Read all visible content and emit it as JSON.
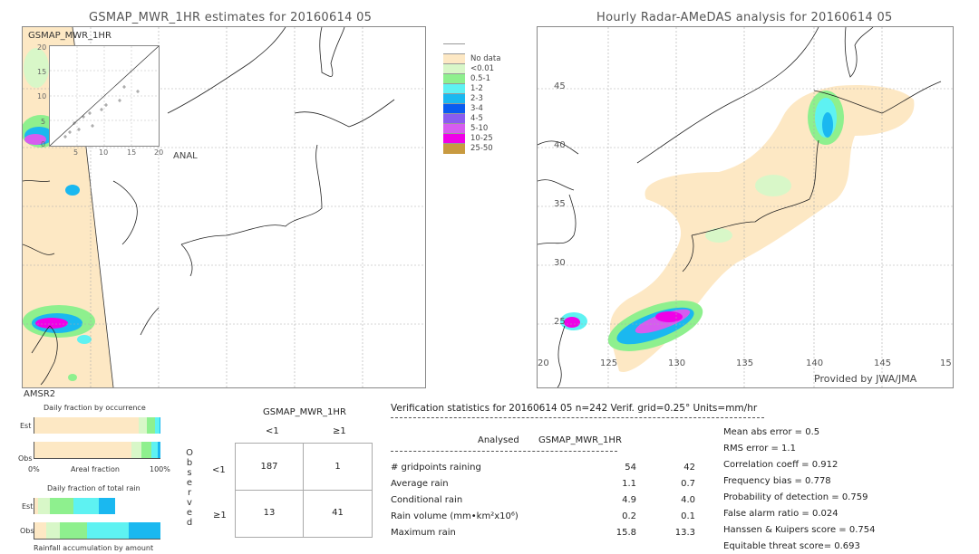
{
  "left_panel": {
    "title": "GSMAP_MWR_1HR estimates for 20160614 05",
    "inset_label": "GSMAP_MWR_1HR",
    "inset_axis_y": [
      "20",
      "15",
      "10",
      "5",
      "0"
    ],
    "inset_axis_x": [
      "5",
      "10",
      "15",
      "20"
    ],
    "inset_xlabel": "ANAL",
    "sensor_label": "AMSR2"
  },
  "right_panel": {
    "title": "Hourly Radar-AMeDAS analysis for 20160614 05",
    "lat_labels": [
      "45",
      "40",
      "35",
      "30",
      "25"
    ],
    "lon_labels": [
      "20",
      "125",
      "130",
      "135",
      "140",
      "145",
      "15"
    ],
    "credit": "Provided by JWA/JMA"
  },
  "legend": {
    "items": [
      {
        "label": "No data",
        "color": "#fde8c4"
      },
      {
        "label": "<0.01",
        "color": "#d8f7c8"
      },
      {
        "label": "0.5-1",
        "color": "#8ef08e"
      },
      {
        "label": "1-2",
        "color": "#5ef2f2"
      },
      {
        "label": "2-3",
        "color": "#1ab8f0"
      },
      {
        "label": "3-4",
        "color": "#0a5cf0"
      },
      {
        "label": "4-5",
        "color": "#8a5cf0"
      },
      {
        "label": "5-10",
        "color": "#d65cf0"
      },
      {
        "label": "10-25",
        "color": "#f000e8"
      },
      {
        "label": "25-50",
        "color": "#c89a40"
      }
    ],
    "top_color": "#ffffff"
  },
  "fraction_charts": {
    "occurrence_title": "Daily fraction by occurrence",
    "est_label": "Est",
    "obs_label": "Obs",
    "axis_left": "0%",
    "axis_mid": "Areal fraction",
    "axis_right": "100%",
    "total_rain_title": "Daily fraction of total rain",
    "accum_title": "Rainfall accumulation by amount",
    "occurrence_est": [
      {
        "fraction": 0.83,
        "color": "#fde8c4"
      },
      {
        "fraction": 0.06,
        "color": "#d8f7c8"
      },
      {
        "fraction": 0.07,
        "color": "#8ef08e"
      },
      {
        "fraction": 0.03,
        "color": "#5ef2f2"
      },
      {
        "fraction": 0.01,
        "color": "#1ab8f0"
      }
    ],
    "occurrence_obs": [
      {
        "fraction": 0.77,
        "color": "#fde8c4"
      },
      {
        "fraction": 0.08,
        "color": "#d8f7c8"
      },
      {
        "fraction": 0.08,
        "color": "#8ef08e"
      },
      {
        "fraction": 0.05,
        "color": "#5ef2f2"
      },
      {
        "fraction": 0.02,
        "color": "#1ab8f0"
      }
    ],
    "total_est": [
      {
        "fraction": 0.03,
        "color": "#fde8c4"
      },
      {
        "fraction": 0.09,
        "color": "#d8f7c8"
      },
      {
        "fraction": 0.19,
        "color": "#8ef08e"
      },
      {
        "fraction": 0.2,
        "color": "#5ef2f2"
      },
      {
        "fraction": 0.13,
        "color": "#1ab8f0"
      }
    ],
    "total_obs": [
      {
        "fraction": 0.09,
        "color": "#fde8c4"
      },
      {
        "fraction": 0.11,
        "color": "#d8f7c8"
      },
      {
        "fraction": 0.22,
        "color": "#8ef08e"
      },
      {
        "fraction": 0.33,
        "color": "#5ef2f2"
      },
      {
        "fraction": 0.25,
        "color": "#1ab8f0"
      }
    ]
  },
  "contingency": {
    "title": "GSMAP_MWR_1HR",
    "col_headers": [
      "<1",
      "≥1"
    ],
    "row_headers": [
      "<1",
      "≥1"
    ],
    "observed_label": [
      "O",
      "b",
      "s",
      "e",
      "r",
      "v",
      "e",
      "d"
    ],
    "cells": [
      [
        "187",
        "1"
      ],
      [
        "13",
        "41"
      ]
    ]
  },
  "verification": {
    "header": "Verification statistics for 20160614 05   n=242   Verif. grid=0.25°   Units=mm/hr",
    "col_analysed": "Analysed",
    "col_model": "GSMAP_MWR_1HR",
    "rows": [
      {
        "label": "# gridpoints raining",
        "analysed": "54",
        "model": "42"
      },
      {
        "label": "Average rain",
        "analysed": "1.1",
        "model": "0.7"
      },
      {
        "label": "Conditional rain",
        "analysed": "4.9",
        "model": "4.0"
      },
      {
        "label": "Rain volume (mm•km²x10⁶)",
        "analysed": "0.2",
        "model": "0.1"
      },
      {
        "label": "Maximum rain",
        "analysed": "15.8",
        "model": "13.3"
      }
    ],
    "scores": [
      "Mean abs error = 0.5",
      "RMS error = 1.1",
      "Correlation coeff = 0.912",
      "Frequency bias = 0.778",
      "Probability of detection = 0.759",
      "False alarm ratio = 0.024",
      "Hanssen & Kuipers score = 0.754",
      "Equitable threat score= 0.693"
    ]
  }
}
